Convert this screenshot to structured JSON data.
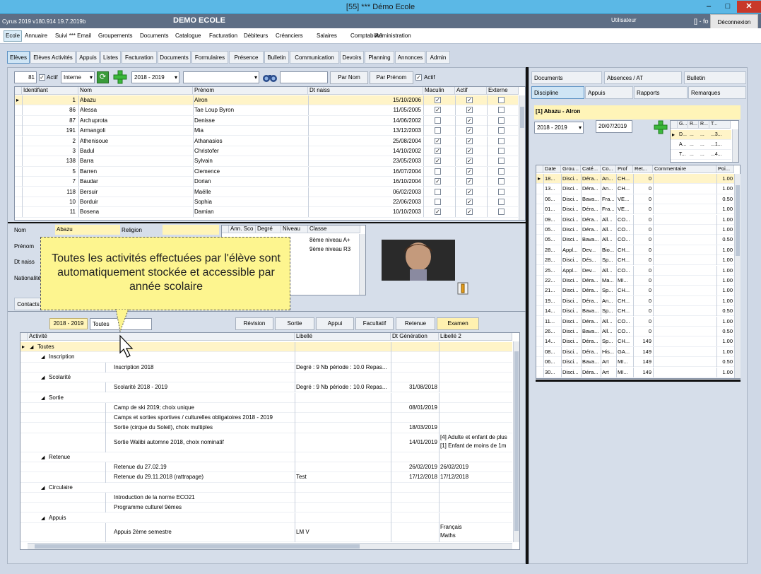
{
  "window": {
    "title": "[55] *** Démo Ecole",
    "min": "–",
    "max": "□",
    "close": "✕"
  },
  "appbar": {
    "version": "Cyrus 2019 v180.914 19.7.2019b",
    "school": "DEMO ECOLE",
    "user": "Utilisateur",
    "user2": "[] - fo",
    "disconnect": "Déconnexion"
  },
  "menu": [
    "Ecole",
    "Annuaire",
    "Suivi *** Email",
    "Groupements",
    "Documents",
    "Catalogue",
    "Facturation",
    "Débiteurs",
    "Créanciers",
    "Salaires",
    "Comptabilité",
    "Administration"
  ],
  "subtabs": [
    "Elèves",
    "Elèves Activités",
    "Appuis",
    "Listes",
    "Facturation",
    "Documents",
    "Formulaires",
    "Présence",
    "Bulletin",
    "Communication",
    "Devoirs",
    "Planning",
    "Annonces",
    "Admin"
  ],
  "filter": {
    "count": "81",
    "actif_label": "Actif",
    "type": "Interne",
    "year": "2018 - 2019",
    "combo": "",
    "search": "",
    "by_name": "Par Nom",
    "by_first": "Par Prénom",
    "actif2": "Actif"
  },
  "students": {
    "headers": [
      "Identifiant",
      "Nom",
      "Prénom",
      "Dt naiss",
      "Maculin",
      "Actif",
      "Externe"
    ],
    "rows": [
      {
        "id": "1",
        "nom": "Abazu",
        "prenom": "Alron",
        "dt": "15/10/2006",
        "m": true,
        "a": true,
        "e": false
      },
      {
        "id": "86",
        "nom": "Alessa",
        "prenom": "Tae Loup Byron",
        "dt": "11/05/2005",
        "m": true,
        "a": true,
        "e": false
      },
      {
        "id": "87",
        "nom": "Archuprota",
        "prenom": "Denisse",
        "dt": "14/06/2002",
        "m": false,
        "a": true,
        "e": false
      },
      {
        "id": "191",
        "nom": "Armangoli",
        "prenom": "Mia",
        "dt": "13/12/2003",
        "m": false,
        "a": true,
        "e": false
      },
      {
        "id": "2",
        "nom": "Athenisoue",
        "prenom": "Athanasios",
        "dt": "25/08/2004",
        "m": true,
        "a": true,
        "e": false
      },
      {
        "id": "3",
        "nom": "Badul",
        "prenom": "Christofer",
        "dt": "14/10/2002",
        "m": true,
        "a": true,
        "e": false
      },
      {
        "id": "138",
        "nom": "Barra",
        "prenom": "Sylvain",
        "dt": "23/05/2003",
        "m": true,
        "a": true,
        "e": false
      },
      {
        "id": "5",
        "nom": "Barren",
        "prenom": "Clemence",
        "dt": "16/07/2004",
        "m": false,
        "a": true,
        "e": false
      },
      {
        "id": "7",
        "nom": "Baudar",
        "prenom": "Dorian",
        "dt": "16/10/2004",
        "m": true,
        "a": true,
        "e": false
      },
      {
        "id": "118",
        "nom": "Bersuir",
        "prenom": "Maëlle",
        "dt": "06/02/2003",
        "m": false,
        "a": true,
        "e": false
      },
      {
        "id": "10",
        "nom": "Borduir",
        "prenom": "Sophia",
        "dt": "22/06/2003",
        "m": false,
        "a": true,
        "e": false
      },
      {
        "id": "11",
        "nom": "Bosena",
        "prenom": "Damian",
        "dt": "10/10/2003",
        "m": true,
        "a": true,
        "e": false
      }
    ]
  },
  "detail": {
    "nom_label": "Nom",
    "nom": "Abazu",
    "religion_label": "Religion",
    "prenom_label": "Prénom",
    "dtnaiss_label": "Dt naiss",
    "nat_label": "Nationalité",
    "classes_headers": [
      "Ann. Sco",
      "Degré",
      "Niveau",
      "Classe"
    ],
    "classes": [
      "8ème niveau A+",
      "9ème niveau R3"
    ],
    "contacts_tab": "Contacts"
  },
  "callout": "Toutes les activités effectuées par l'élève sont automatiquement stockée et accessible par année scolaire",
  "activity": {
    "year": "2018 - 2019",
    "filter": "Toutes",
    "buttons": [
      "Révision",
      "Sortie",
      "Appui",
      "Facultatif",
      "Retenue",
      "Examen"
    ],
    "headers": [
      "Activité",
      "Libellé",
      "Dt Génération",
      "Libellé 2"
    ],
    "tree": [
      {
        "lvl": 0,
        "t": "Toutes",
        "lib": "",
        "dt": "",
        "l2": "",
        "sel": true
      },
      {
        "lvl": 1,
        "t": "Inscription",
        "lib": "",
        "dt": "",
        "l2": ""
      },
      {
        "lvl": 2,
        "t": "Inscription 2018",
        "lib": "Degré : 9 Nb période : 10.0 Repas...",
        "dt": "",
        "l2": ""
      },
      {
        "lvl": 1,
        "t": "Scolarité",
        "lib": "",
        "dt": "",
        "l2": ""
      },
      {
        "lvl": 2,
        "t": "Scolarité 2018 - 2019",
        "lib": "Degré : 9 Nb période : 10.0 Repas...",
        "dt": "31/08/2018",
        "l2": ""
      },
      {
        "lvl": 1,
        "t": "Sortie",
        "lib": "",
        "dt": "",
        "l2": ""
      },
      {
        "lvl": 2,
        "t": "Camp de ski 2019; choix unique",
        "lib": "",
        "dt": "08/01/2019",
        "l2": ""
      },
      {
        "lvl": 2,
        "t": "Camps et sorties sportives / culturelles obligatoires 2018 - 2019",
        "lib": "",
        "dt": "",
        "l2": ""
      },
      {
        "lvl": 2,
        "t": "Sortie (cirque du Soleil), choix multiples",
        "lib": "",
        "dt": "18/03/2019",
        "l2": ""
      },
      {
        "lvl": 2,
        "t": "Sortie Walibi automne 2018, choix nominatif",
        "lib": "",
        "dt": "14/01/2019",
        "l2": "[4] Adulte et enfant de plus",
        "l2b": "[1] Enfant de moins de 1m",
        "tall": true
      },
      {
        "lvl": 1,
        "t": "Retenue",
        "lib": "",
        "dt": "",
        "l2": ""
      },
      {
        "lvl": 2,
        "t": "Retenue du 27.02.19",
        "lib": "",
        "dt": "26/02/2019",
        "l2": "26/02/2019"
      },
      {
        "lvl": 2,
        "t": "Retenue du 29.11.2018 (rattrapage)",
        "lib": "Test",
        "dt": "17/12/2018",
        "l2": "17/12/2018"
      },
      {
        "lvl": 1,
        "t": "Circulaire",
        "lib": "",
        "dt": "",
        "l2": ""
      },
      {
        "lvl": 2,
        "t": "Introduction de la norme ECO21",
        "lib": "",
        "dt": "",
        "l2": ""
      },
      {
        "lvl": 2,
        "t": "Programme culturel 9èmes",
        "lib": "",
        "dt": "",
        "l2": ""
      },
      {
        "lvl": 1,
        "t": "Appuis",
        "lib": "",
        "dt": "",
        "l2": ""
      },
      {
        "lvl": 2,
        "t": "Appuis 2ème semestre",
        "lib": "LM  V",
        "dt": "",
        "l2": "Français",
        "l2b": "Maths",
        "tall": true
      }
    ]
  },
  "right": {
    "tabs1": [
      "Documents",
      "Absences / AT",
      "Bulletin"
    ],
    "tabs2": [
      "Discipline",
      "Appuis",
      "Rapports",
      "Remarques"
    ],
    "student": "[1] Abazu - Alron",
    "year": "2018 - 2019",
    "date": "20/07/2019",
    "mini_headers": [
      "G...",
      "R...",
      "R...",
      "T..."
    ],
    "mini_rows": [
      [
        "D...",
        "...",
        "...",
        "...3..."
      ],
      [
        "A...",
        "...",
        "...",
        "...1..."
      ],
      [
        "T...",
        "...",
        "...",
        "...4..."
      ]
    ],
    "headers": [
      "Date",
      "Grou...",
      "Caté...",
      "Co...",
      "Prof",
      "Ret...",
      "Commentaire",
      "Poi..."
    ],
    "rows": [
      [
        "18...",
        "Disci...",
        "Déra...",
        "An...",
        "CH...",
        "0",
        "",
        "1.00"
      ],
      [
        "13...",
        "Disci...",
        "Déra...",
        "An...",
        "CH...",
        "0",
        "",
        "1.00"
      ],
      [
        "06...",
        "Disci...",
        "Bava...",
        "Fra...",
        "VE...",
        "0",
        "",
        "0.50"
      ],
      [
        "01...",
        "Disci...",
        "Déra...",
        "Fra...",
        "VE...",
        "0",
        "",
        "1.00"
      ],
      [
        "09...",
        "Disci...",
        "Déra...",
        "All...",
        "CO...",
        "0",
        "",
        "1.00"
      ],
      [
        "05...",
        "Disci...",
        "Déra...",
        "All...",
        "CO...",
        "0",
        "",
        "1.00"
      ],
      [
        "05...",
        "Disci...",
        "Bava...",
        "All...",
        "CO...",
        "0",
        "",
        "0.50"
      ],
      [
        "28...",
        "Appl...",
        "Dev...",
        "Bio...",
        "CH...",
        "0",
        "",
        "1.00"
      ],
      [
        "28...",
        "Disci...",
        "Dés...",
        "Sp...",
        "CH...",
        "0",
        "",
        "1.00"
      ],
      [
        "25...",
        "Appl...",
        "Dev...",
        "All...",
        "CO...",
        "0",
        "",
        "1.00"
      ],
      [
        "22...",
        "Disci...",
        "Déra...",
        "Ma...",
        "MI...",
        "0",
        "",
        "1.00"
      ],
      [
        "21...",
        "Disci...",
        "Déra...",
        "Sp...",
        "CH...",
        "0",
        "",
        "1.00"
      ],
      [
        "19...",
        "Disci...",
        "Déra...",
        "An...",
        "CH...",
        "0",
        "",
        "1.00"
      ],
      [
        "14...",
        "Disci...",
        "Bava...",
        "Sp...",
        "CH...",
        "0",
        "",
        "0.50"
      ],
      [
        "11...",
        "Disci...",
        "Déra...",
        "All...",
        "CO...",
        "0",
        "",
        "1.00"
      ],
      [
        "26...",
        "Disci...",
        "Bava...",
        "All...",
        "CO...",
        "0",
        "",
        "0.50"
      ],
      [
        "14...",
        "Disci...",
        "Déra...",
        "Sp...",
        "CH...",
        "149",
        "",
        "1.00"
      ],
      [
        "08...",
        "Disci...",
        "Déra...",
        "His...",
        "GA...",
        "149",
        "",
        "1.00"
      ],
      [
        "06...",
        "Disci...",
        "Bava...",
        "Art",
        "MI...",
        "149",
        "",
        "0.50"
      ],
      [
        "30...",
        "Disci...",
        "Déra...",
        "Art",
        "MI...",
        "149",
        "",
        "1.00"
      ]
    ]
  }
}
